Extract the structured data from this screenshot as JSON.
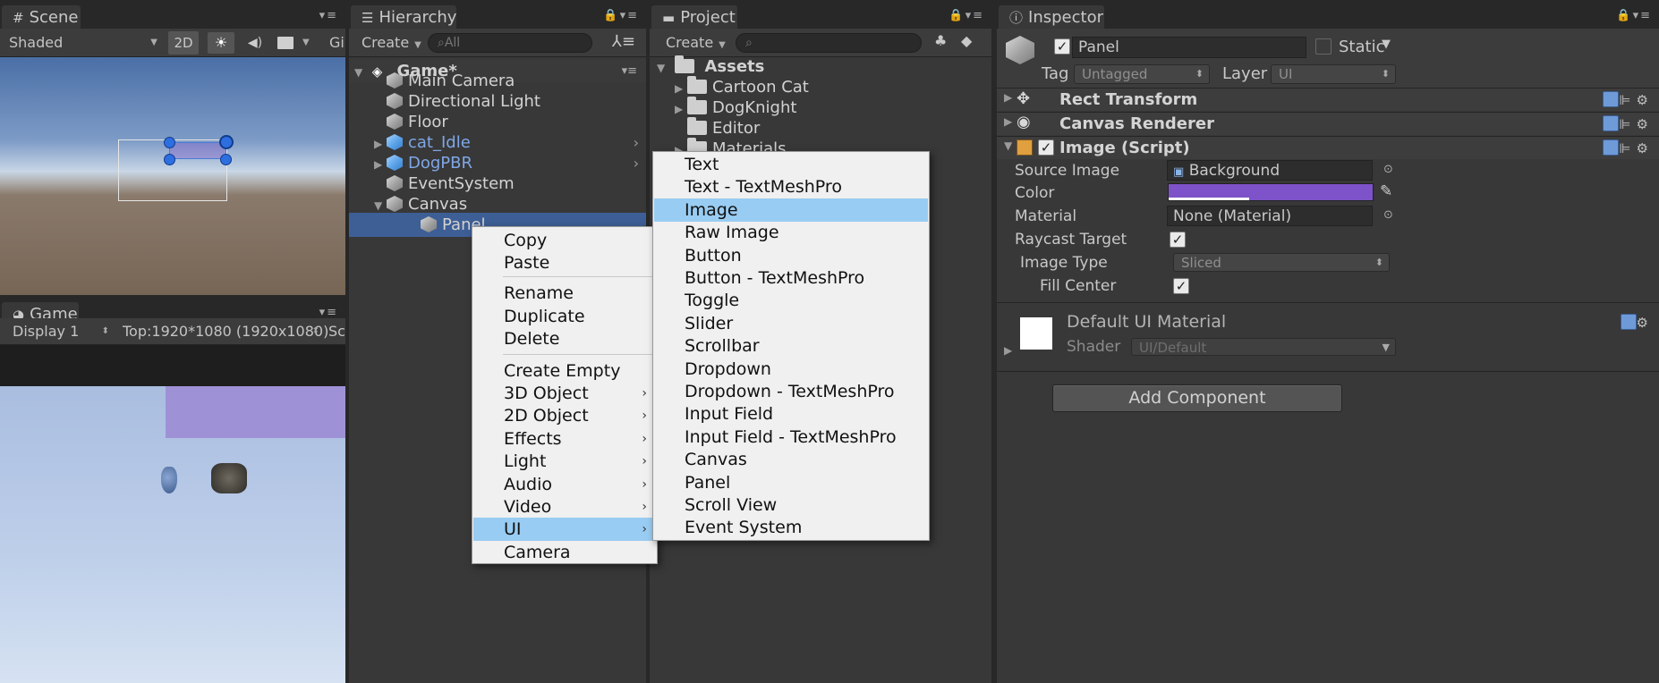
{
  "scene": {
    "tab_label": "Scene",
    "tab_icon": "scene-grid-icon",
    "shading": "Shaded",
    "mode_2d": "2D",
    "gizmos_cut": "Gi"
  },
  "game": {
    "tab_label": "Game",
    "tab_icon": "pacman-icon",
    "display": "Display 1",
    "resolution": "Top:1920*1080 (1920x1080)",
    "scale_cut": "Sc"
  },
  "hierarchy": {
    "tab_label": "Hierarchy",
    "create_label": "Create",
    "search_placeholder": "All",
    "scene_name": "Game*",
    "items": [
      {
        "label": "Main Camera",
        "prefab": false,
        "expandable": false,
        "selected": false
      },
      {
        "label": "Directional Light",
        "prefab": false,
        "expandable": false,
        "selected": false
      },
      {
        "label": "Floor",
        "prefab": false,
        "expandable": false,
        "selected": false
      },
      {
        "label": "cat_Idle",
        "prefab": true,
        "expandable": true,
        "selected": false
      },
      {
        "label": "DogPBR",
        "prefab": true,
        "expandable": true,
        "selected": false
      },
      {
        "label": "EventSystem",
        "prefab": false,
        "expandable": false,
        "selected": false
      },
      {
        "label": "Canvas",
        "prefab": false,
        "expandable": true,
        "selected": false
      },
      {
        "label": "Panel",
        "prefab": false,
        "expandable": false,
        "selected": true
      }
    ]
  },
  "project": {
    "tab_label": "Project",
    "create_label": "Create",
    "root_folder": "Assets",
    "folders": [
      "Cartoon Cat",
      "DogKnight",
      "Editor",
      "Materials"
    ]
  },
  "context_menu": {
    "group1": [
      "Copy",
      "Paste"
    ],
    "group2": [
      "Rename",
      "Duplicate",
      "Delete"
    ],
    "group3": [
      {
        "label": "Create Empty",
        "has_sub": false,
        "highlight": false
      },
      {
        "label": "3D Object",
        "has_sub": true,
        "highlight": false
      },
      {
        "label": "2D Object",
        "has_sub": true,
        "highlight": false
      },
      {
        "label": "Effects",
        "has_sub": true,
        "highlight": false
      },
      {
        "label": "Light",
        "has_sub": true,
        "highlight": false
      },
      {
        "label": "Audio",
        "has_sub": true,
        "highlight": false
      },
      {
        "label": "Video",
        "has_sub": true,
        "highlight": false
      },
      {
        "label": "UI",
        "has_sub": true,
        "highlight": true
      },
      {
        "label": "Camera",
        "has_sub": false,
        "highlight": false
      }
    ]
  },
  "ui_submenu": {
    "items": [
      "Text",
      "Text - TextMeshPro",
      "Image",
      "Raw Image",
      "Button",
      "Button - TextMeshPro",
      "Toggle",
      "Slider",
      "Scrollbar",
      "Dropdown",
      "Dropdown - TextMeshPro",
      "Input Field",
      "Input Field - TextMeshPro",
      "Canvas",
      "Panel",
      "Scroll View",
      "Event System"
    ],
    "highlight": "Image"
  },
  "inspector": {
    "tab_label": "Inspector",
    "object_name": "Panel",
    "static_label": "Static",
    "tag_label": "Tag",
    "tag_value": "Untagged",
    "layer_label": "Layer",
    "layer_value": "UI",
    "components": {
      "rect_transform": "Rect Transform",
      "canvas_renderer": "Canvas Renderer",
      "image_script": "Image (Script)"
    },
    "image_props": {
      "source_image_label": "Source Image",
      "source_image_value": "Background",
      "color_label": "Color",
      "color_value": "#7e52c8",
      "material_label": "Material",
      "material_value": "None (Material)",
      "raycast_label": "Raycast Target",
      "image_type_label": "Image Type",
      "image_type_value": "Sliced",
      "fill_center_label": "Fill Center"
    },
    "material_name": "Default UI Material",
    "shader_label": "Shader",
    "shader_value": "UI/Default",
    "add_component": "Add Component"
  }
}
